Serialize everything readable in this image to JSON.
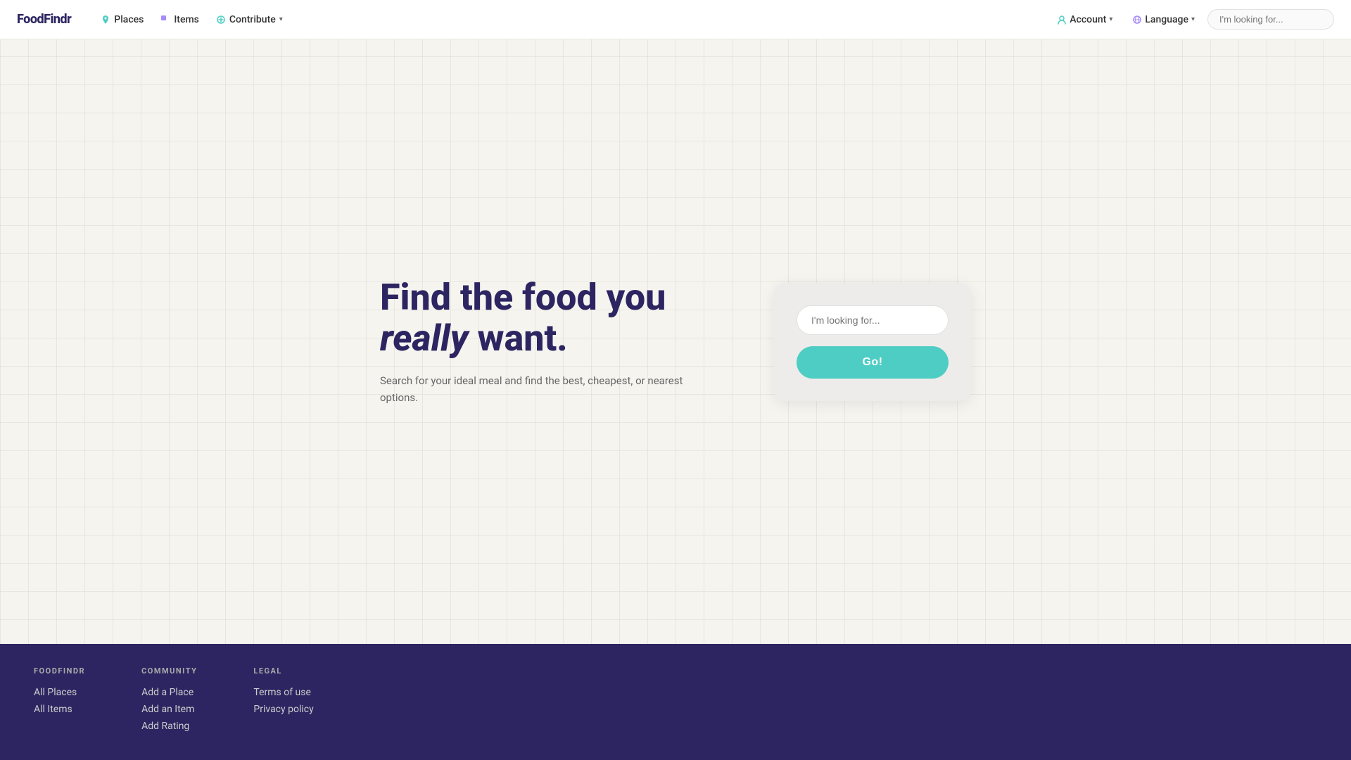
{
  "nav": {
    "logo": "FoodFindr",
    "links": [
      {
        "label": "Places",
        "icon": "map-pin",
        "color": "#4ecdc4",
        "has_dropdown": false
      },
      {
        "label": "Items",
        "icon": "tag",
        "color": "#a78bfa",
        "has_dropdown": false
      },
      {
        "label": "Contribute",
        "icon": "circle",
        "color": "#4ecdc4",
        "has_dropdown": true
      }
    ],
    "account_label": "Account",
    "language_label": "Language",
    "search_placeholder": "I'm looking for..."
  },
  "hero": {
    "title_normal": "Find the food you ",
    "title_italic": "really",
    "title_end": " want.",
    "subtitle": "Search for your ideal meal and find the best, cheapest, or nearest options.",
    "search_placeholder": "I'm looking for...",
    "go_button_label": "Go!"
  },
  "footer": {
    "brand_label": "FOODFINDR",
    "brand_links": [
      {
        "label": "All Places"
      },
      {
        "label": "All Items"
      }
    ],
    "community_label": "COMMUNITY",
    "community_links": [
      {
        "label": "Add a Place"
      },
      {
        "label": "Add an Item"
      },
      {
        "label": "Add Rating"
      }
    ],
    "legal_label": "LEGAL",
    "legal_links": [
      {
        "label": "Terms of use"
      },
      {
        "label": "Privacy policy"
      }
    ]
  }
}
